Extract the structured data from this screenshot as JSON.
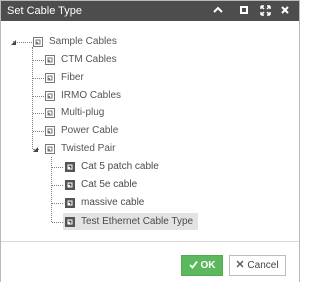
{
  "window": {
    "title": "Set Cable Type",
    "collapse_icon": "chevron-up-icon",
    "restore_icon": "window-restore-icon",
    "maximize_icon": "expand-icon",
    "close_icon": "close-icon"
  },
  "tree": {
    "root": {
      "label": "Sample Cables",
      "expanded": true,
      "icon": "cable-folder-icon"
    },
    "items": [
      {
        "label": "CTM Cables",
        "icon": "cable-folder-icon"
      },
      {
        "label": "Fiber",
        "icon": "cable-folder-icon"
      },
      {
        "label": "IRMO Cables",
        "icon": "cable-folder-icon"
      },
      {
        "label": "Multi-plug",
        "icon": "cable-folder-icon"
      },
      {
        "label": "Power Cable",
        "icon": "cable-folder-icon"
      },
      {
        "label": "Twisted Pair",
        "icon": "cable-folder-icon",
        "expanded": true,
        "children": [
          {
            "label": "Cat 5 patch cable",
            "icon": "cable-type-icon"
          },
          {
            "label": "Cat 5e cable",
            "icon": "cable-type-icon"
          },
          {
            "label": "massive cable",
            "icon": "cable-type-icon"
          },
          {
            "label": "Test Ethernet Cable Type",
            "icon": "cable-type-icon",
            "selected": true
          }
        ]
      }
    ]
  },
  "footer": {
    "ok_label": "OK",
    "cancel_label": "Cancel"
  },
  "colors": {
    "titlebar": "#4d4d4d",
    "ok_button": "#5cb85c",
    "selected_row": "#e3e3e3"
  }
}
